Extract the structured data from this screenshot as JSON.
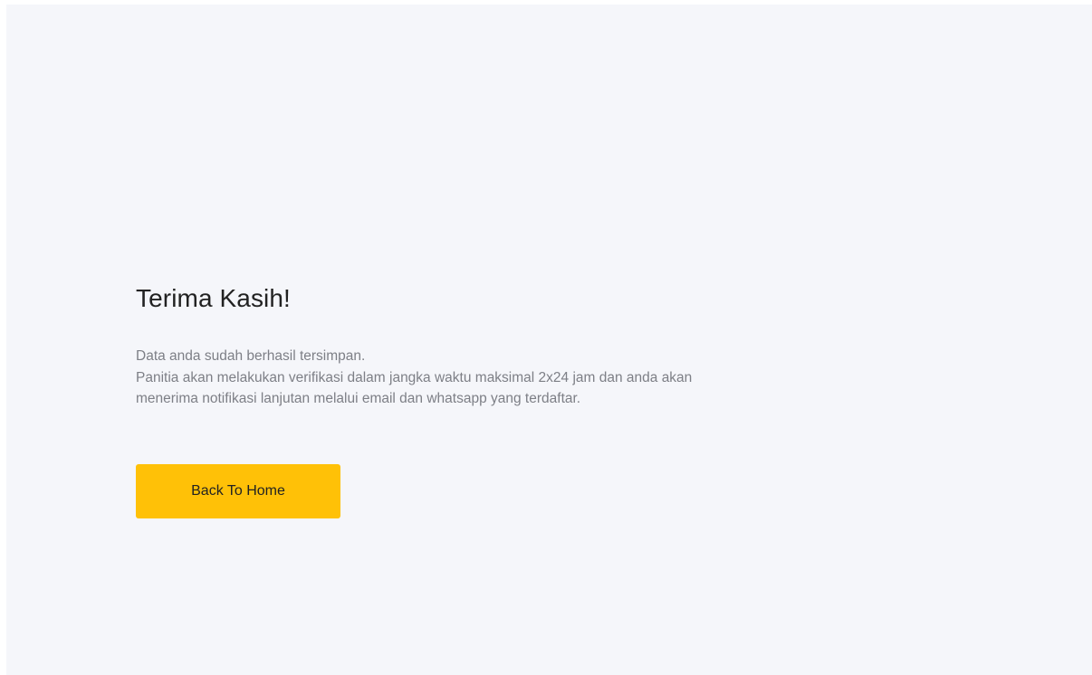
{
  "thankyou": {
    "title": "Terima Kasih!",
    "message_lines": [
      "Data anda sudah berhasil tersimpan.",
      "Panitia akan melakukan verifikasi dalam jangka waktu maksimal 2x24 jam dan anda akan",
      "menerima notifikasi lanjutan melalui email dan whatsapp yang terdaftar."
    ],
    "button_label": "Back To Home"
  },
  "colors": {
    "background": "#f5f6fa",
    "button": "#ffc107",
    "title_text": "#222222",
    "body_text": "#7d7f86"
  }
}
